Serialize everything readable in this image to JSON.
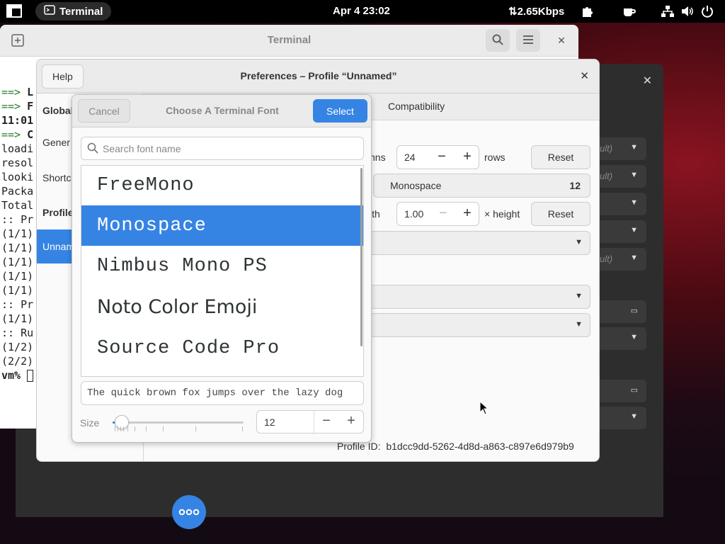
{
  "topbar": {
    "app_name": "Terminal",
    "clock": "Apr 4  23:02",
    "network_speed": "2.65Kbps",
    "icons": [
      "activities-icon",
      "terminal-app-icon",
      "network-speed-icon",
      "puzzle-icon",
      "coffee-icon",
      "network-icon",
      "volume-icon",
      "power-icon"
    ]
  },
  "background_window": {
    "combo_placeholder": "ult)"
  },
  "terminal": {
    "title": "Terminal",
    "lines": [
      {
        "arrow": "==> ",
        "text": "L"
      },
      {
        "arrow": "==> ",
        "text": "F"
      },
      {
        "arrow": "",
        "text": "11:01"
      },
      {
        "arrow": "==> ",
        "text": "C"
      },
      {
        "arrow": "",
        "text": "loadi"
      },
      {
        "arrow": "",
        "text": "resol"
      },
      {
        "arrow": "",
        "text": "looki"
      },
      {
        "arrow": "",
        "text": ""
      },
      {
        "arrow": "",
        "text": "Packa"
      },
      {
        "arrow": "",
        "text": ""
      },
      {
        "arrow": "",
        "text": "Total"
      },
      {
        "arrow": "",
        "text": ""
      },
      {
        "arrow": "",
        "text": ":: Pr"
      },
      {
        "arrow": "",
        "text": "(1/1)"
      },
      {
        "arrow": "",
        "text": "(1/1)"
      },
      {
        "arrow": "",
        "text": "(1/1)"
      },
      {
        "arrow": "",
        "text": "(1/1)"
      },
      {
        "arrow": "",
        "text": "(1/1)"
      },
      {
        "arrow": "",
        "text": ":: Pr"
      },
      {
        "arrow": "",
        "text": "(1/1)"
      },
      {
        "arrow": "",
        "text": ":: Ru"
      },
      {
        "arrow": "",
        "text": "(1/2)"
      },
      {
        "arrow": "",
        "text": "(2/2)"
      },
      {
        "arrow": "",
        "text": "vm% "
      }
    ]
  },
  "prefs": {
    "help_label": "Help",
    "title": "Preferences – Profile “Unnamed”",
    "sidebar": {
      "global": "Global",
      "general": "Gener",
      "shortcuts": "Shortc",
      "profiles": "Profile",
      "unnamed": "Unnam"
    },
    "tab_compat": "Compatibility",
    "columns_label": "nns",
    "columns_value": "24",
    "rows_label": "rows",
    "reset_label": "Reset",
    "font_name": "Monospace",
    "font_size": "12",
    "width_label": "lth",
    "width_value": "1.00",
    "height_label": "× height",
    "profile_id_label": "Profile ID:",
    "profile_id": "b1dcc9dd-5262-4d8d-a863-c897e6d979b9"
  },
  "chooser": {
    "cancel_label": "Cancel",
    "title": "Choose A Terminal Font",
    "select_label": "Select",
    "search_placeholder": "Search font name",
    "fonts": [
      {
        "name": "FreeMono",
        "selected": false
      },
      {
        "name": "Monospace",
        "selected": true
      },
      {
        "name": "Nimbus Mono PS",
        "selected": false
      },
      {
        "name": "Noto Color Emoji",
        "selected": false
      },
      {
        "name": "Source Code Pro",
        "selected": false
      }
    ],
    "preview_text": "The quick brown fox jumps over the lazy dog",
    "size_label": "Size",
    "size_value": "12",
    "size_slider_fraction": 0.05
  },
  "colors": {
    "accent": "#3584e4",
    "topbar": "#000000"
  }
}
